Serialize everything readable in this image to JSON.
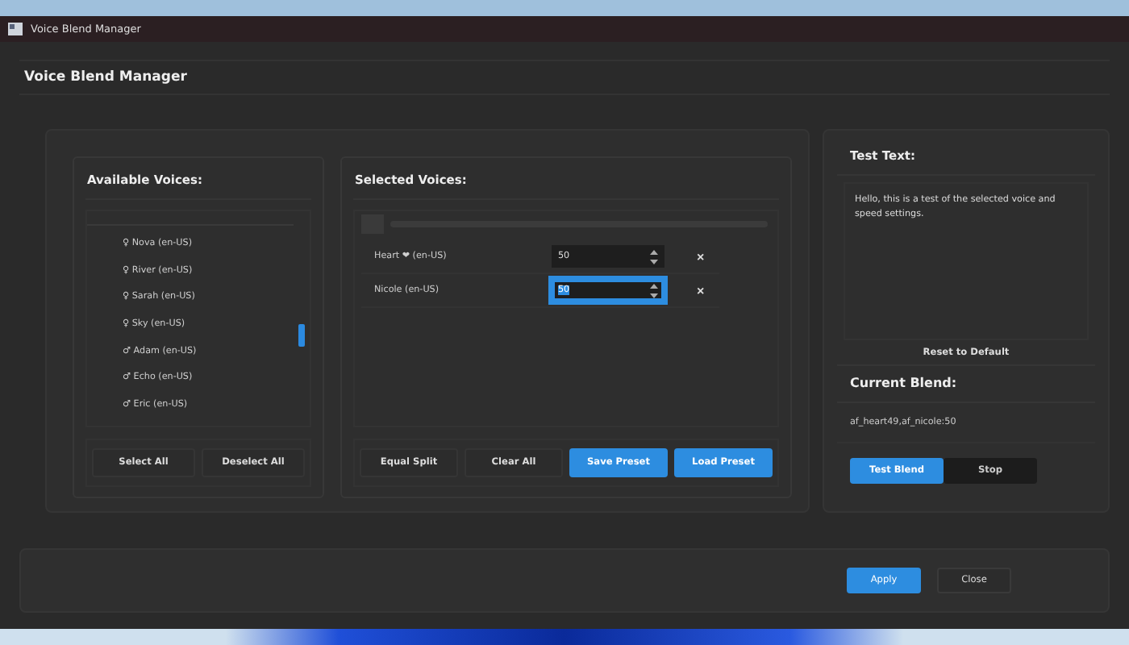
{
  "window": {
    "title": "Voice Blend Manager"
  },
  "header": {
    "title": "Voice Blend Manager"
  },
  "available": {
    "title": "Available Voices:",
    "voices": [
      {
        "label": "♀ Nova (en-US)"
      },
      {
        "label": "♀ River (en-US)"
      },
      {
        "label": "♀ Sarah (en-US)"
      },
      {
        "label": "♀ Sky (en-US)"
      },
      {
        "label": "♂ Adam (en-US)"
      },
      {
        "label": "♂ Echo (en-US)"
      },
      {
        "label": "♂ Eric (en-US)"
      }
    ],
    "buttons": [
      "Select All",
      "Deselect All"
    ]
  },
  "selected": {
    "title": "Selected Voices:",
    "voices": [
      {
        "label": "Heart ❤ (en-US)",
        "weight": "50",
        "focused": false,
        "remove": "×"
      },
      {
        "label": "Nicole (en-US)",
        "weight": "50",
        "focused": true,
        "remove": "×"
      }
    ],
    "buttons": [
      {
        "label": "Equal Split",
        "primary": false
      },
      {
        "label": "Clear All",
        "primary": false
      },
      {
        "label": "Save Preset",
        "primary": true
      },
      {
        "label": "Load Preset",
        "primary": true
      }
    ]
  },
  "test": {
    "title": "Test Text:",
    "text": "Hello, this is a test of the selected voice and speed settings.",
    "reset": "Reset to Default"
  },
  "blend": {
    "title": "Current Blend:",
    "value": "af_heart49,af_nicole:50",
    "buttons": [
      {
        "label": "Test Blend",
        "primary": true
      },
      {
        "label": "Stop",
        "primary": false
      }
    ]
  },
  "footer": {
    "buttons": [
      {
        "label": "Apply",
        "primary": true
      },
      {
        "label": "Close",
        "primary": false
      }
    ]
  }
}
